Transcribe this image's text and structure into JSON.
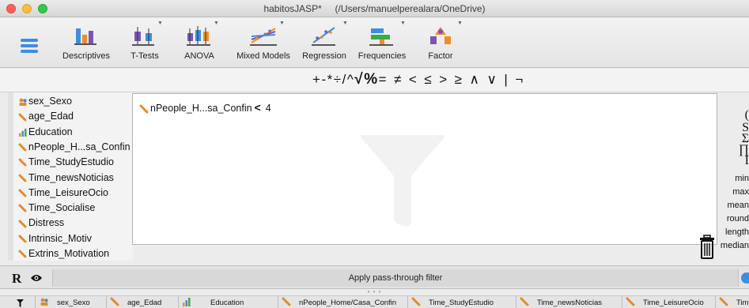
{
  "window": {
    "title": "habitosJASP*     (/Users/manuelperealara/OneDrive)"
  },
  "ribbon": {
    "menu_icon": "hamburger-menu-icon",
    "buttons": [
      {
        "label": "Descriptives",
        "icon": "descriptives-icon"
      },
      {
        "label": "T-Tests",
        "icon": "ttests-icon"
      },
      {
        "label": "ANOVA",
        "icon": "anova-icon"
      },
      {
        "label": "Mixed Models",
        "icon": "mixed-models-icon"
      },
      {
        "label": "Regression",
        "icon": "regression-icon"
      },
      {
        "label": "Frequencies",
        "icon": "frequencies-icon"
      },
      {
        "label": "Factor",
        "icon": "factor-icon"
      }
    ],
    "colors": {
      "accent": "#3e8ee0",
      "orange": "#f08c2c",
      "purple": "#7a55b5",
      "green": "#3aaa48"
    }
  },
  "operators": [
    "+",
    "-",
    "*",
    "÷",
    "/",
    "^",
    "√",
    "%",
    "=",
    "≠",
    "<",
    "≤",
    ">",
    "≥",
    "∧",
    "∨",
    "|",
    "¬"
  ],
  "variables": [
    {
      "name": "sex_Sexo",
      "type": "nominal-text"
    },
    {
      "name": "age_Edad",
      "type": "scale"
    },
    {
      "name": "Education",
      "type": "ordinal"
    },
    {
      "name": "nPeople_H...sa_Confin",
      "type": "scale"
    },
    {
      "name": "Time_StudyEstudio",
      "type": "scale"
    },
    {
      "name": "Time_newsNoticias",
      "type": "scale"
    },
    {
      "name": "Time_LeisureOcio",
      "type": "scale"
    },
    {
      "name": "Time_Socialise",
      "type": "scale"
    },
    {
      "name": "Distress",
      "type": "scale"
    },
    {
      "name": "Intrinsic_Motiv",
      "type": "scale"
    },
    {
      "name": "Extrins_Motivation",
      "type": "scale"
    }
  ],
  "filter": {
    "variable": "nPeople_H...sa_Confin",
    "operator": "<",
    "value": "4"
  },
  "functions": {
    "partial_glyphs": [
      "(",
      "S",
      "Σ",
      "∏",
      "I"
    ],
    "items": [
      "min",
      "max",
      "mean",
      "round",
      "length",
      "median"
    ]
  },
  "bottom_bar": {
    "r_label": "R",
    "apply_label": "Apply pass-through filter"
  },
  "splitter_dots": "• • •",
  "table_columns": [
    {
      "label": "sex_Sexo",
      "type": "nominal-text"
    },
    {
      "label": "age_Edad",
      "type": "scale"
    },
    {
      "label": "Education",
      "type": "ordinal"
    },
    {
      "label": "nPeople_Home/Casa_Confin",
      "type": "scale"
    },
    {
      "label": "Time_StudyEstudio",
      "type": "scale"
    },
    {
      "label": "Time_newsNoticias",
      "type": "scale"
    },
    {
      "label": "Time_LeisureOcio",
      "type": "scale"
    },
    {
      "label": "Time_",
      "type": "scale"
    }
  ]
}
